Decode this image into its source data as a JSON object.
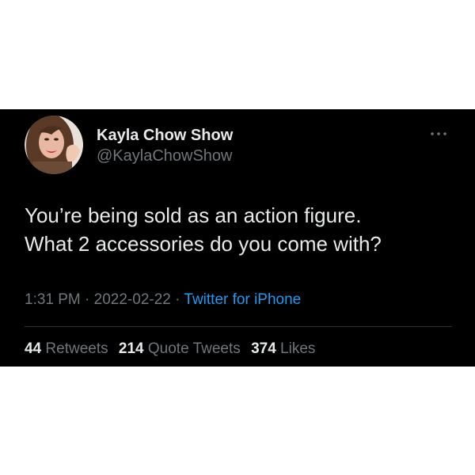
{
  "tweet": {
    "author": {
      "display_name": "Kayla Chow Show",
      "handle": "@KaylaChowShow"
    },
    "text_lines": [
      "You’re being sold as an action figure.",
      "What 2 accessories do you come with?"
    ],
    "time": "1:31 PM",
    "separator": "·",
    "date": "2022-02-22",
    "source": "Twitter for iPhone",
    "stats": {
      "retweets_count": "44",
      "retweets_label": "Retweets",
      "quote_tweets_count": "214",
      "quote_tweets_label": "Quote Tweets",
      "likes_count": "374",
      "likes_label": "Likes"
    },
    "icons": {
      "more": "more-options-icon"
    }
  },
  "colors": {
    "card_background": "#000000",
    "primary_text": "#e7e9ea",
    "secondary_text": "#71767b",
    "link": "#1d9bf0",
    "page_background": "#ffffff"
  }
}
